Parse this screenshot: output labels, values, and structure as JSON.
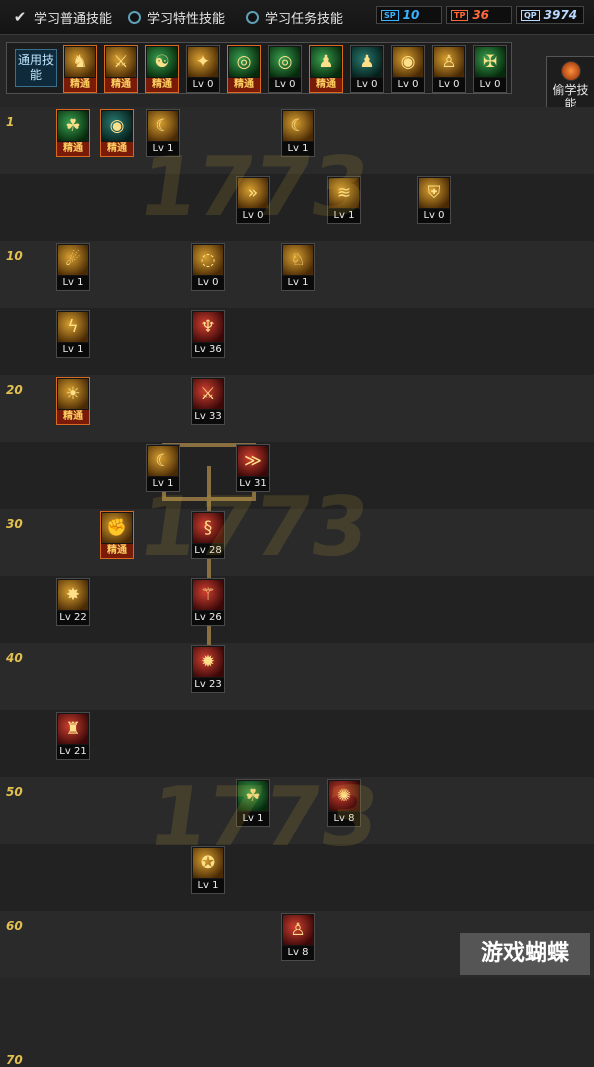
{
  "filters": [
    {
      "label": "学习普通技能",
      "checked": true
    },
    {
      "label": "学习特性技能",
      "checked": false
    },
    {
      "label": "学习任务技能",
      "checked": false
    }
  ],
  "points": [
    {
      "tag": "SP",
      "value": "10",
      "color": "#39b4ff"
    },
    {
      "tag": "TP",
      "value": "36",
      "color": "#ff6a3a"
    },
    {
      "tag": "QP",
      "value": "3974",
      "color": "#b8d8ff"
    }
  ],
  "general_label": "通用技能",
  "general_skills": [
    {
      "icon": "♞",
      "label": "精通",
      "style": "gold"
    },
    {
      "icon": "⚔",
      "label": "精通",
      "style": "gold"
    },
    {
      "icon": "☯",
      "label": "精通",
      "style": "green"
    },
    {
      "icon": "✦",
      "label": "Lv 0",
      "style": "gold"
    },
    {
      "icon": "◎",
      "label": "精通",
      "style": "green"
    },
    {
      "icon": "◎",
      "label": "Lv 0",
      "style": "green"
    },
    {
      "icon": "♟",
      "label": "精通",
      "style": "green"
    },
    {
      "icon": "♟",
      "label": "Lv 0",
      "style": "teal"
    },
    {
      "icon": "◉",
      "label": "Lv 0",
      "style": "gold"
    },
    {
      "icon": "♙",
      "label": "Lv 0",
      "style": "gold"
    },
    {
      "icon": "✠",
      "label": "Lv 0",
      "style": "green"
    }
  ],
  "steal_label": "偷学技能",
  "level_markers": [
    "1",
    "10",
    "20",
    "30",
    "40",
    "50",
    "60",
    "70"
  ],
  "tree_skills": [
    {
      "row": 0,
      "col": 0,
      "icon": "☘",
      "label": "精通",
      "style": "green"
    },
    {
      "row": 0,
      "col": 1,
      "icon": "◉",
      "label": "精通",
      "style": "teal"
    },
    {
      "row": 0,
      "col": 2,
      "icon": "☾",
      "label": "Lv 1",
      "style": "gold"
    },
    {
      "row": 0,
      "col": 5,
      "icon": "☾",
      "label": "Lv 1",
      "style": "gold"
    },
    {
      "row": 1,
      "col": 4,
      "icon": "»",
      "label": "Lv 0",
      "style": "gold"
    },
    {
      "row": 1,
      "col": 6,
      "icon": "≋",
      "label": "Lv 1",
      "style": "gold"
    },
    {
      "row": 1,
      "col": 8,
      "icon": "⛨",
      "label": "Lv 0",
      "style": "gold"
    },
    {
      "row": 2,
      "col": 0,
      "icon": "☄",
      "label": "Lv 1",
      "style": "gold"
    },
    {
      "row": 2,
      "col": 3,
      "icon": "◌",
      "label": "Lv 0",
      "style": "gold"
    },
    {
      "row": 2,
      "col": 5,
      "icon": "♘",
      "label": "Lv 1",
      "style": "gold"
    },
    {
      "row": 3,
      "col": 0,
      "icon": "ϟ",
      "label": "Lv 1",
      "style": "gold"
    },
    {
      "row": 3,
      "col": 3,
      "icon": "♆",
      "label": "Lv 36",
      "style": "red"
    },
    {
      "row": 4,
      "col": 0,
      "icon": "☀",
      "label": "精通",
      "style": "gold"
    },
    {
      "row": 4,
      "col": 3,
      "icon": "⚔",
      "label": "Lv 33",
      "style": "red"
    },
    {
      "row": 5,
      "col": 2,
      "icon": "☾",
      "label": "Lv 1",
      "style": "gold"
    },
    {
      "row": 5,
      "col": 4,
      "icon": "≫",
      "label": "Lv 31",
      "style": "red"
    },
    {
      "row": 6,
      "col": 1,
      "icon": "✊",
      "label": "精通",
      "style": "gold"
    },
    {
      "row": 6,
      "col": 3,
      "icon": "§",
      "label": "Lv 28",
      "style": "red"
    },
    {
      "row": 7,
      "col": 0,
      "icon": "✸",
      "label": "Lv 22",
      "style": "gold"
    },
    {
      "row": 7,
      "col": 3,
      "icon": "⚚",
      "label": "Lv 26",
      "style": "red"
    },
    {
      "row": 8,
      "col": 3,
      "icon": "✹",
      "label": "Lv 23",
      "style": "red"
    },
    {
      "row": 9,
      "col": 0,
      "icon": "♜",
      "label": "Lv 21",
      "style": "red"
    },
    {
      "row": 10,
      "col": 4,
      "icon": "☘",
      "label": "Lv 1",
      "style": "green"
    },
    {
      "row": 10,
      "col": 6,
      "icon": "✺",
      "label": "Lv 8",
      "style": "red"
    },
    {
      "row": 11,
      "col": 3,
      "icon": "✪",
      "label": "Lv 1",
      "style": "gold"
    },
    {
      "row": 12,
      "col": 5,
      "icon": "♙",
      "label": "Lv 8",
      "style": "red"
    }
  ],
  "watermark_text": "1773",
  "corner_logo": "游戏蝴蝶"
}
